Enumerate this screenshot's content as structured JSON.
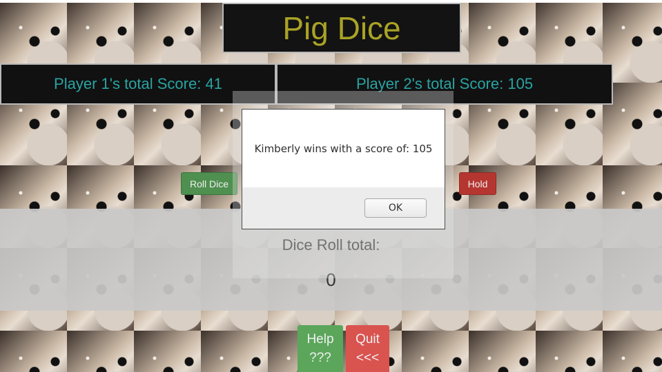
{
  "title": "Pig Dice",
  "scores": {
    "player1": "Player 1's total Score: 41",
    "player2": "Player 2's total Score: 105"
  },
  "controls": {
    "roll_label": "Roll Dice",
    "hold_label": "Hold"
  },
  "dice_total": {
    "label": "Dice Roll total:",
    "value": "0"
  },
  "bottom": {
    "help_line1": "Help",
    "help_line2": "???",
    "quit_line1": "Quit",
    "quit_line2": "<<<"
  },
  "dialog": {
    "message": "Kimberly wins with a score of: 105",
    "ok_label": "OK"
  },
  "colors": {
    "title": "#a9a326",
    "score_text": "#2aa3a3",
    "roll_button": "#4f8f4f",
    "hold_button": "#b53631",
    "help_button": "#5ba65b",
    "quit_button": "#d9534f"
  }
}
